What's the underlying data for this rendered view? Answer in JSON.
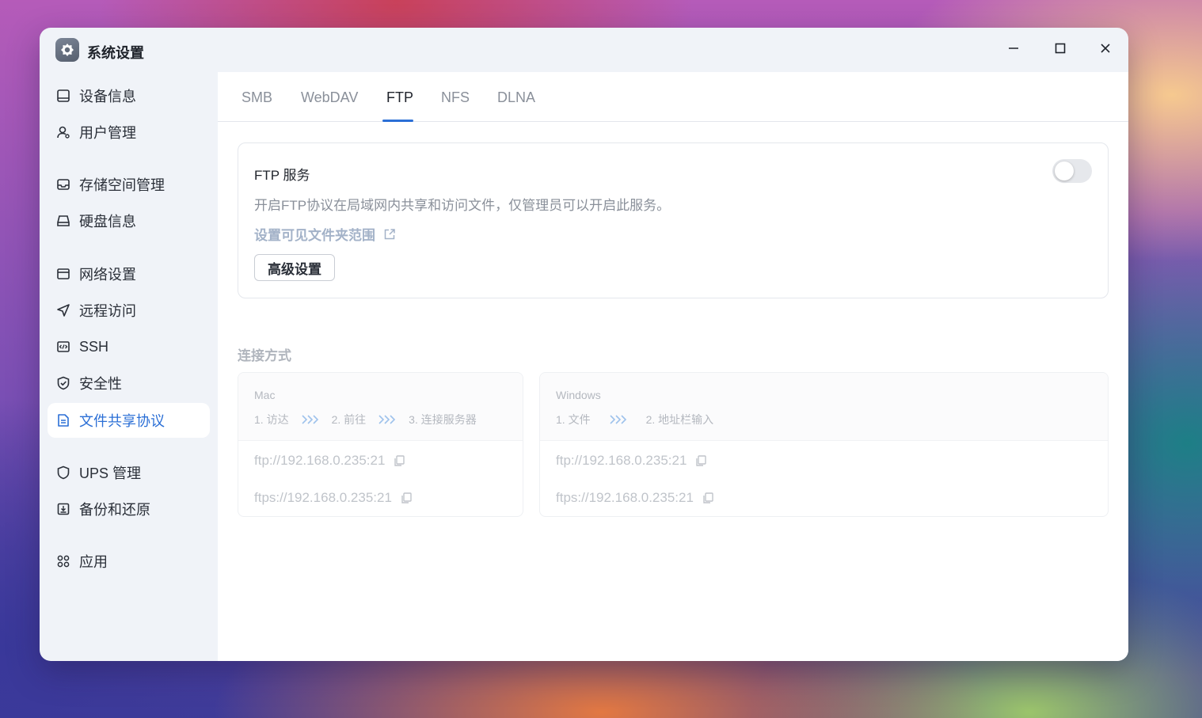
{
  "window": {
    "title": "系统设置",
    "app_icon": "gear-icon"
  },
  "sidebar": {
    "items": [
      {
        "label": "设备信息",
        "icon": "device-icon"
      },
      {
        "label": "用户管理",
        "icon": "user-icon"
      },
      {
        "label": "存储空间管理",
        "icon": "storage-icon"
      },
      {
        "label": "硬盘信息",
        "icon": "disk-icon"
      },
      {
        "label": "网络设置",
        "icon": "network-icon"
      },
      {
        "label": "远程访问",
        "icon": "send-icon"
      },
      {
        "label": "SSH",
        "icon": "code-icon"
      },
      {
        "label": "安全性",
        "icon": "shield-check-icon"
      },
      {
        "label": "文件共享协议",
        "icon": "document-icon",
        "active": true
      },
      {
        "label": "UPS 管理",
        "icon": "shield-icon"
      },
      {
        "label": "备份和还原",
        "icon": "backup-icon"
      },
      {
        "label": "应用",
        "icon": "apps-grid-icon"
      }
    ]
  },
  "tabs": [
    {
      "label": "SMB"
    },
    {
      "label": "WebDAV"
    },
    {
      "label": "FTP",
      "active": true
    },
    {
      "label": "NFS"
    },
    {
      "label": "DLNA"
    }
  ],
  "ftp_service": {
    "title": "FTP 服务",
    "description": "开启FTP协议在局域网内共享和访问文件，仅管理员可以开启此服务。",
    "link_label": "设置可见文件夹范围",
    "advanced_button": "高级设置",
    "enabled": false
  },
  "connection": {
    "section_title": "连接方式",
    "mac": {
      "name": "Mac",
      "steps": [
        "1. 访达",
        "2. 前往",
        "3. 连接服务器"
      ],
      "addresses": [
        "ftp://192.168.0.235:21",
        "ftps://192.168.0.235:21"
      ]
    },
    "windows": {
      "name": "Windows",
      "steps": [
        "1. 文件",
        "2. 地址栏输入"
      ],
      "addresses": [
        "ftp://192.168.0.235:21",
        "ftps://192.168.0.235:21"
      ]
    }
  },
  "colors": {
    "accent": "#2b6fd6",
    "link": "#a3b2c8",
    "muted": "#8a909a"
  }
}
